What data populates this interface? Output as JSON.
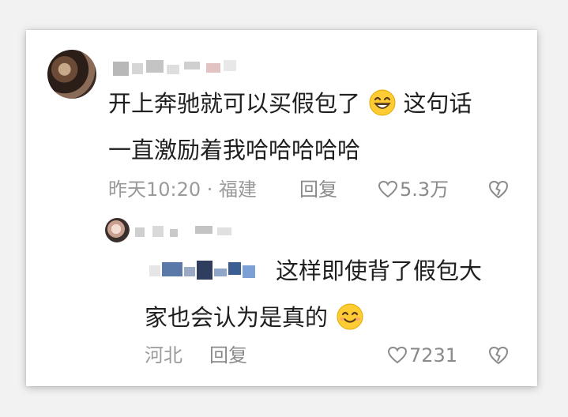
{
  "comments": [
    {
      "text_line1": "开上奔驰就可以买假包了",
      "text_line2_after": "这句话",
      "text_line2": "一直激励着我哈哈哈哈哈",
      "meta": "昨天10:20 · 福建",
      "reply_label": "回复",
      "likes": "5.3万",
      "emoji": "grinning-face-emoji"
    },
    {
      "text_line1": "这样即使背了假包大",
      "text_line2": "家也会认为是真的",
      "meta": "河北",
      "reply_label": "回复",
      "likes": "7231",
      "emoji": "smiling-face-emoji"
    }
  ],
  "colors": {
    "text": "#1f1f1f",
    "meta": "#9a9a9a",
    "card": "#ffffff",
    "background": "#f2f2f2"
  }
}
